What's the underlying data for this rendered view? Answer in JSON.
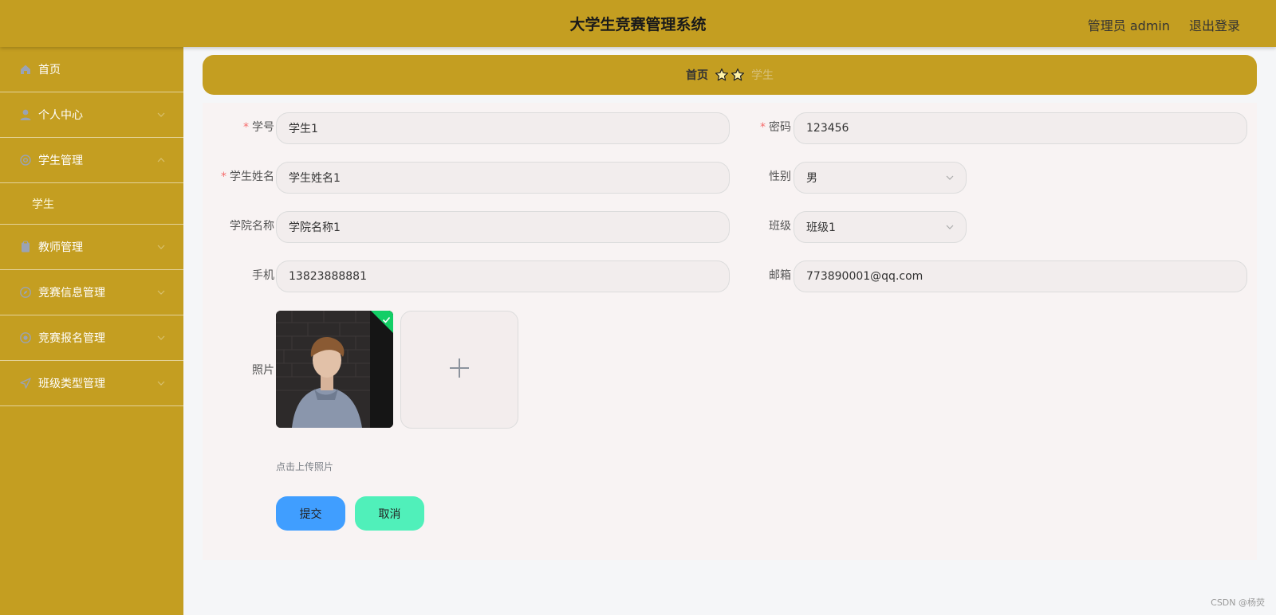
{
  "header": {
    "title": "大学生竞赛管理系统",
    "user": "管理员 admin",
    "logout": "退出登录"
  },
  "sidebar": {
    "items": [
      {
        "label": "首页",
        "icon": "home-icon"
      },
      {
        "label": "个人中心",
        "icon": "user-icon"
      },
      {
        "label": "学生管理",
        "icon": "settings-icon",
        "expanded": true
      },
      {
        "label": "学生",
        "sub": true,
        "active": true
      },
      {
        "label": "教师管理",
        "icon": "clipboard-icon"
      },
      {
        "label": "竞赛信息管理",
        "icon": "compass-icon"
      },
      {
        "label": "竞赛报名管理",
        "icon": "badge-icon"
      },
      {
        "label": "班级类型管理",
        "icon": "send-icon"
      }
    ]
  },
  "breadcrumb": {
    "home": "首页",
    "current": "学生"
  },
  "form": {
    "student_id": {
      "label": "学号",
      "value": "学生1",
      "required": true
    },
    "password": {
      "label": "密码",
      "value": "123456",
      "required": true
    },
    "student_name": {
      "label": "学生姓名",
      "value": "学生姓名1",
      "required": true
    },
    "gender": {
      "label": "性别",
      "value": "男"
    },
    "college": {
      "label": "学院名称",
      "value": "学院名称1"
    },
    "class": {
      "label": "班级",
      "value": "班级1"
    },
    "phone": {
      "label": "手机",
      "value": "13823888881"
    },
    "email": {
      "label": "邮箱",
      "value": "773890001@qq.com"
    },
    "photo": {
      "label": "照片",
      "tip": "点击上传照片"
    },
    "submit": "提交",
    "cancel": "取消"
  },
  "watermark": "CSDN @杨荧",
  "colors": {
    "brand": "#c49e21",
    "submit": "#409eff",
    "cancel": "#50f0ba",
    "required": "#f56c6c",
    "success": "#13ce66"
  }
}
